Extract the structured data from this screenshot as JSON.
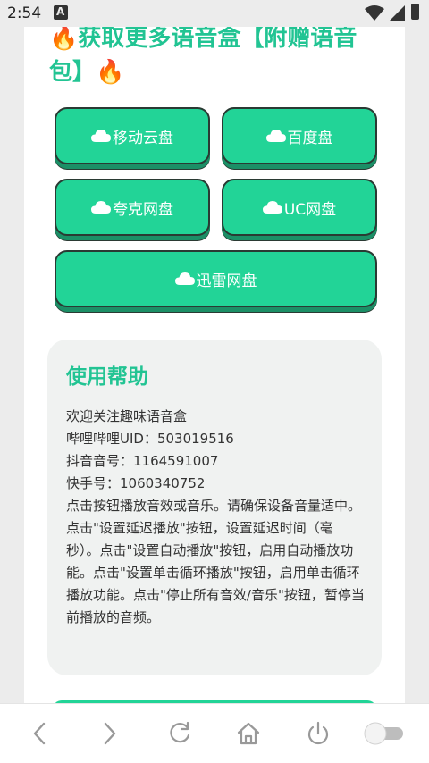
{
  "status_bar": {
    "time": "2:54"
  },
  "title": {
    "text": "🔥获取更多语音盒【附赠语音包】🔥"
  },
  "buttons": [
    {
      "label": "移动云盘"
    },
    {
      "label": "百度盘"
    },
    {
      "label": "夸克网盘"
    },
    {
      "label": "UC网盘"
    },
    {
      "label": "迅雷网盘"
    }
  ],
  "help": {
    "heading": "使用帮助",
    "lines": [
      "欢迎关注趣味语音盒",
      "哔哩哔哩UID：503019516",
      "抖音音号：1164591007",
      "快手号：1060340752"
    ],
    "instructions": "点击按钮播放音效或音乐。请确保设备音量适中。点击\"设置延迟播放\"按钮，设置延迟时间（毫秒）。点击\"设置自动播放\"按钮，启用自动播放功能。点击\"设置单击循环播放\"按钮，启用单击循环播放功能。点击\"停止所有音效/音乐\"按钮，暂停当前播放的音频。"
  },
  "colors": {
    "accent": "#22d497",
    "accent_text": "#22c493",
    "panel": "#f0f2f1"
  },
  "icons": [
    "cloud-icon",
    "back-icon",
    "forward-icon",
    "refresh-icon",
    "home-icon",
    "power-icon",
    "toggle-switch"
  ]
}
